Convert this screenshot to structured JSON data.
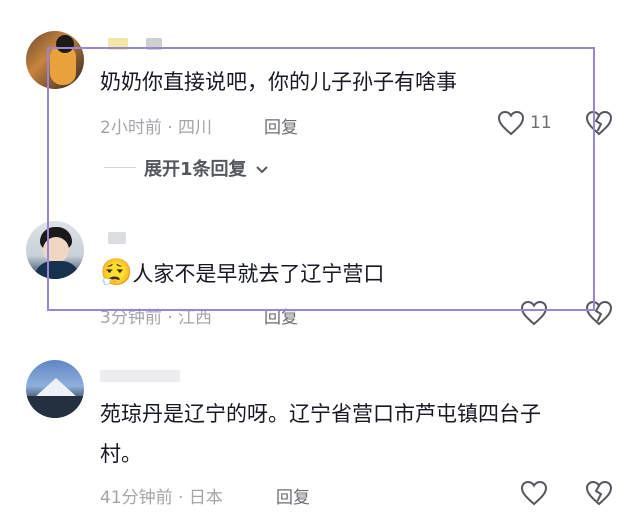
{
  "comments": [
    {
      "text": "奶奶你直接说吧，你的儿子孙子有啥事",
      "meta": "2小时前 · 四川",
      "reply_label": "回复",
      "likes": "11",
      "expand_label": "展开1条回复"
    },
    {
      "emoji": "😮‍💨",
      "text": "人家不是早就去了辽宁营口",
      "meta": "3分钟前 · 江西",
      "reply_label": "回复"
    },
    {
      "text_line1": "苑琼丹是辽宁的呀。辽宁省营口市芦屯镇四台子",
      "text_line2": "村。",
      "meta": "41分钟前 · 日本",
      "reply_label": "回复"
    }
  ],
  "colors": {
    "highlight_border": "#9b84d8",
    "meta_text": "#a3a5ab",
    "primary_text": "#161823"
  },
  "icons": [
    "heart-icon",
    "broken-heart-icon",
    "chevron-down-icon"
  ]
}
